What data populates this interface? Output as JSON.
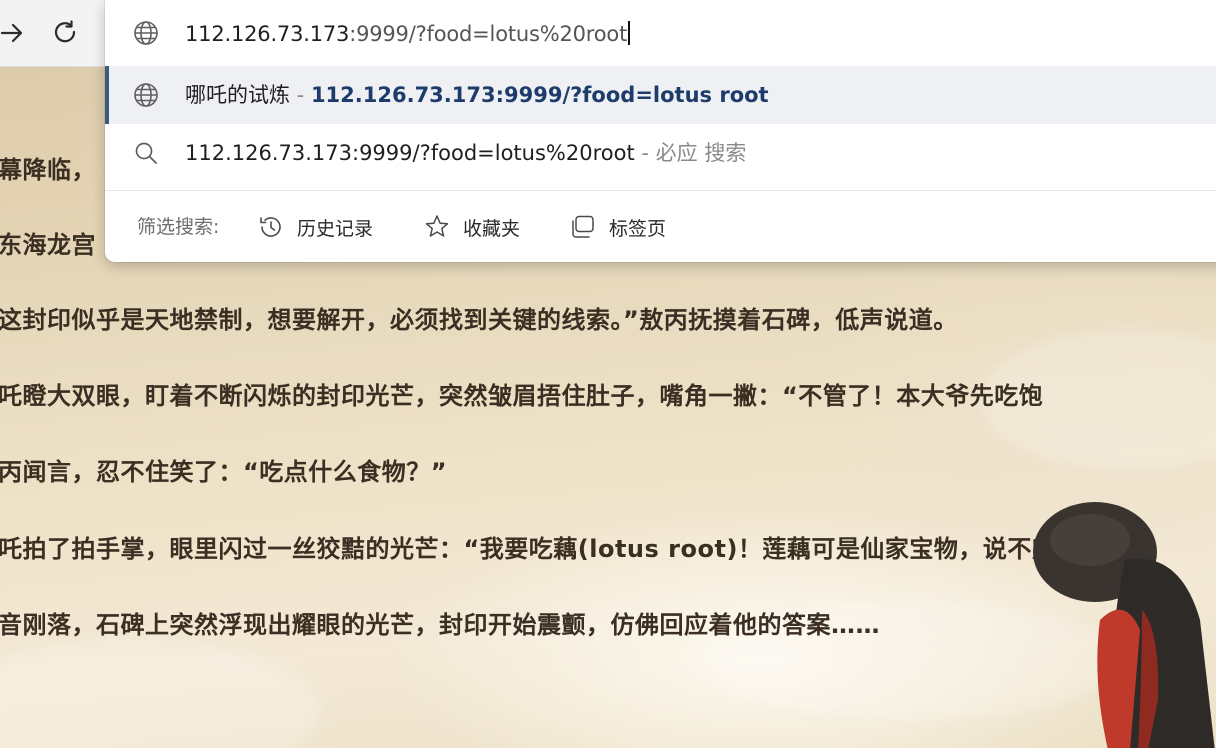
{
  "address_bar": {
    "url_host": "112.126.73.173",
    "url_rest": ":9999/?food=lotus%20root"
  },
  "suggestions": [
    {
      "icon": "globe-icon",
      "title": "哪吒的试炼",
      "separator": " - ",
      "url": "112.126.73.173:9999/?food=lotus root"
    },
    {
      "icon": "search-icon",
      "query": "112.126.73.173:9999/?food=lotus%20root",
      "separator": " - ",
      "engine": "必应 搜索"
    }
  ],
  "filters": {
    "label": "筛选搜索:",
    "chips": [
      {
        "icon": "history-icon",
        "label": "历史记录"
      },
      {
        "icon": "star-icon",
        "label": "收藏夹"
      },
      {
        "icon": "tabs-icon",
        "label": "标签页"
      }
    ]
  },
  "story": {
    "lines": [
      "幕降临，",
      "东海龙宫",
      "这封印似乎是天地禁制，想要解开，必须找到关键的线索。”敖丙抚摸着石碑，低声说道。",
      "吒瞪大双眼，盯着不断闪烁的封印光芒，突然皱眉捂住肚子，嘴角一撇：“不管了！本大爷先吃饱",
      "丙闻言，忍不住笑了：“吃点什么食物？”",
      "吒拍了拍手掌，眼里闪过一丝狡黠的光芒：“我要吃藕(lotus root)！莲藕可是仙家宝物，说不定",
      "音刚落，石碑上突然浮现出耀眼的光芒，封印开始震颤，仿佛回应着他的答案……"
    ]
  }
}
